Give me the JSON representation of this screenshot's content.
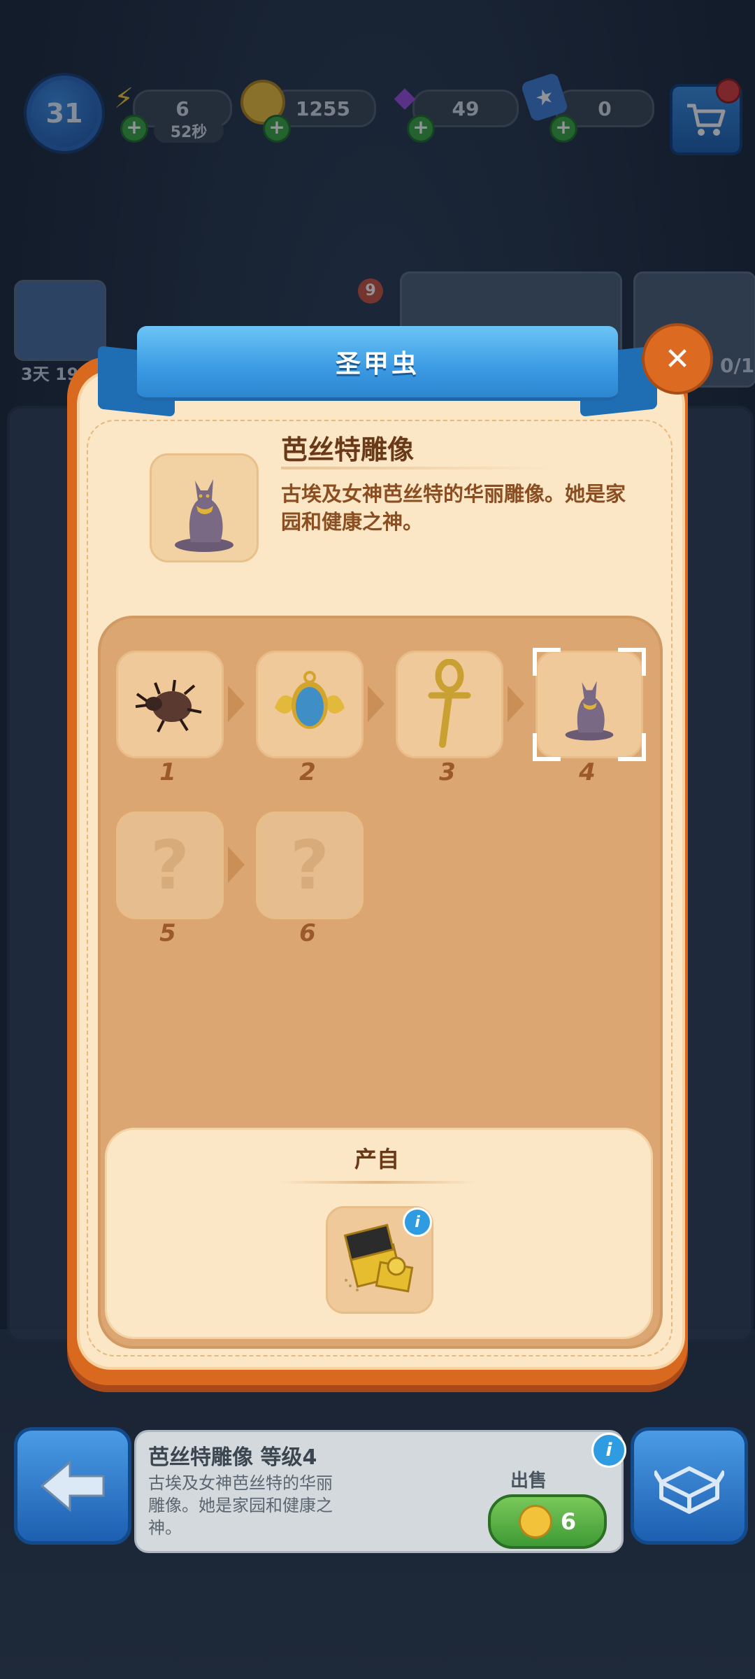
{
  "hud": {
    "level": "31",
    "energy": "6",
    "energy_timer": "52秒",
    "coins": "1255",
    "gems": "49",
    "cards": "0"
  },
  "background": {
    "event_timer": "3天 19",
    "card_progress": "0/1",
    "badge_count": "9"
  },
  "modal": {
    "title": "圣甲虫",
    "close_label": "✕",
    "item_name": "芭丝特雕像",
    "item_description": "古埃及女神芭丝特的华丽雕像。她是家园和健康之神。",
    "chain": [
      {
        "level": "1",
        "icon": "beetle-icon",
        "known": true
      },
      {
        "level": "2",
        "icon": "scarab-amulet-icon",
        "known": true
      },
      {
        "level": "3",
        "icon": "ankh-icon",
        "known": true
      },
      {
        "level": "4",
        "icon": "bastet-statue-icon",
        "known": true,
        "selected": true
      },
      {
        "level": "5",
        "icon": "question-icon",
        "known": false,
        "glyph": "?"
      },
      {
        "level": "6",
        "icon": "question-icon",
        "known": false,
        "glyph": "?"
      }
    ],
    "origin_title": "产自",
    "origin_icon": "treasure-chest-icon",
    "info_glyph": "i"
  },
  "bottom": {
    "card_title": "芭丝特雕像 等级4",
    "card_description": "古埃及女神芭丝特的华丽雕像。她是家园和健康之神。",
    "sell_label": "出售",
    "sell_price": "6",
    "info_glyph": "i"
  },
  "colors": {
    "ribbon": "#3a9ae3",
    "modal_border": "#d9691f",
    "panel": "#dba671",
    "sell_button": "#3f9a35"
  }
}
